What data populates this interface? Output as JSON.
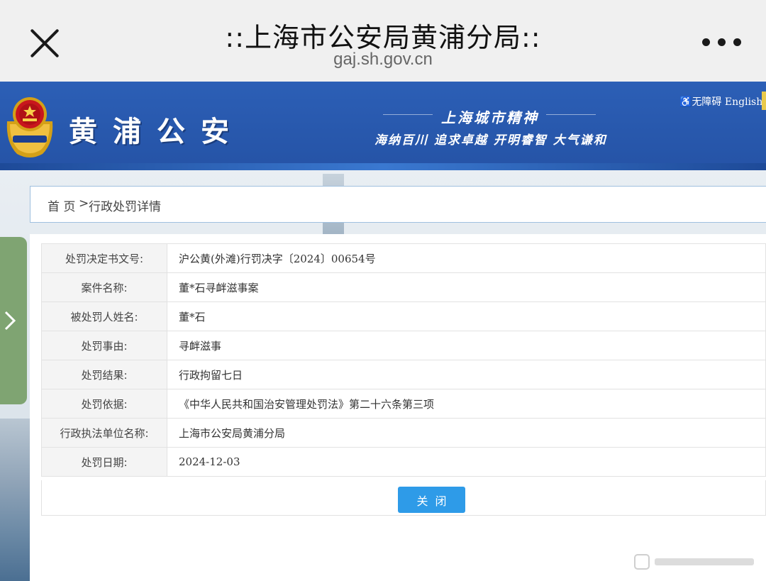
{
  "browser": {
    "title": "::上海市公安局黄浦分局::",
    "url": "gaj.sh.gov.cn"
  },
  "header": {
    "site_name": "黄浦公安",
    "slogan_title": "上海城市精神",
    "slogan_text": "海纳百川 追求卓越 开明睿智 大气谦和",
    "accessibility_label": "无障碍",
    "language_label": "English"
  },
  "breadcrumb": {
    "home": "首 页",
    "separator": ">",
    "current": "行政处罚详情"
  },
  "details": [
    {
      "label": "处罚决定书文号:",
      "value": "沪公黄(外滩)行罚决字〔2024〕00654号"
    },
    {
      "label": "案件名称:",
      "value": "董*石寻衅滋事案"
    },
    {
      "label": "被处罚人姓名:",
      "value": "董*石"
    },
    {
      "label": "处罚事由:",
      "value": "寻衅滋事"
    },
    {
      "label": "处罚结果:",
      "value": "行政拘留七日"
    },
    {
      "label": "处罚依据:",
      "value": "《中华人民共和国治安管理处罚法》第二十六条第三项"
    },
    {
      "label": "行政执法单位名称:",
      "value": "上海市公安局黄浦分局"
    },
    {
      "label": "处罚日期:",
      "value": "2024-12-03"
    }
  ],
  "actions": {
    "close_label": "关闭"
  },
  "colors": {
    "header_blue": "#2c5fb6",
    "button_blue": "#2e9be8",
    "side_tab_green": "#7fa472"
  }
}
